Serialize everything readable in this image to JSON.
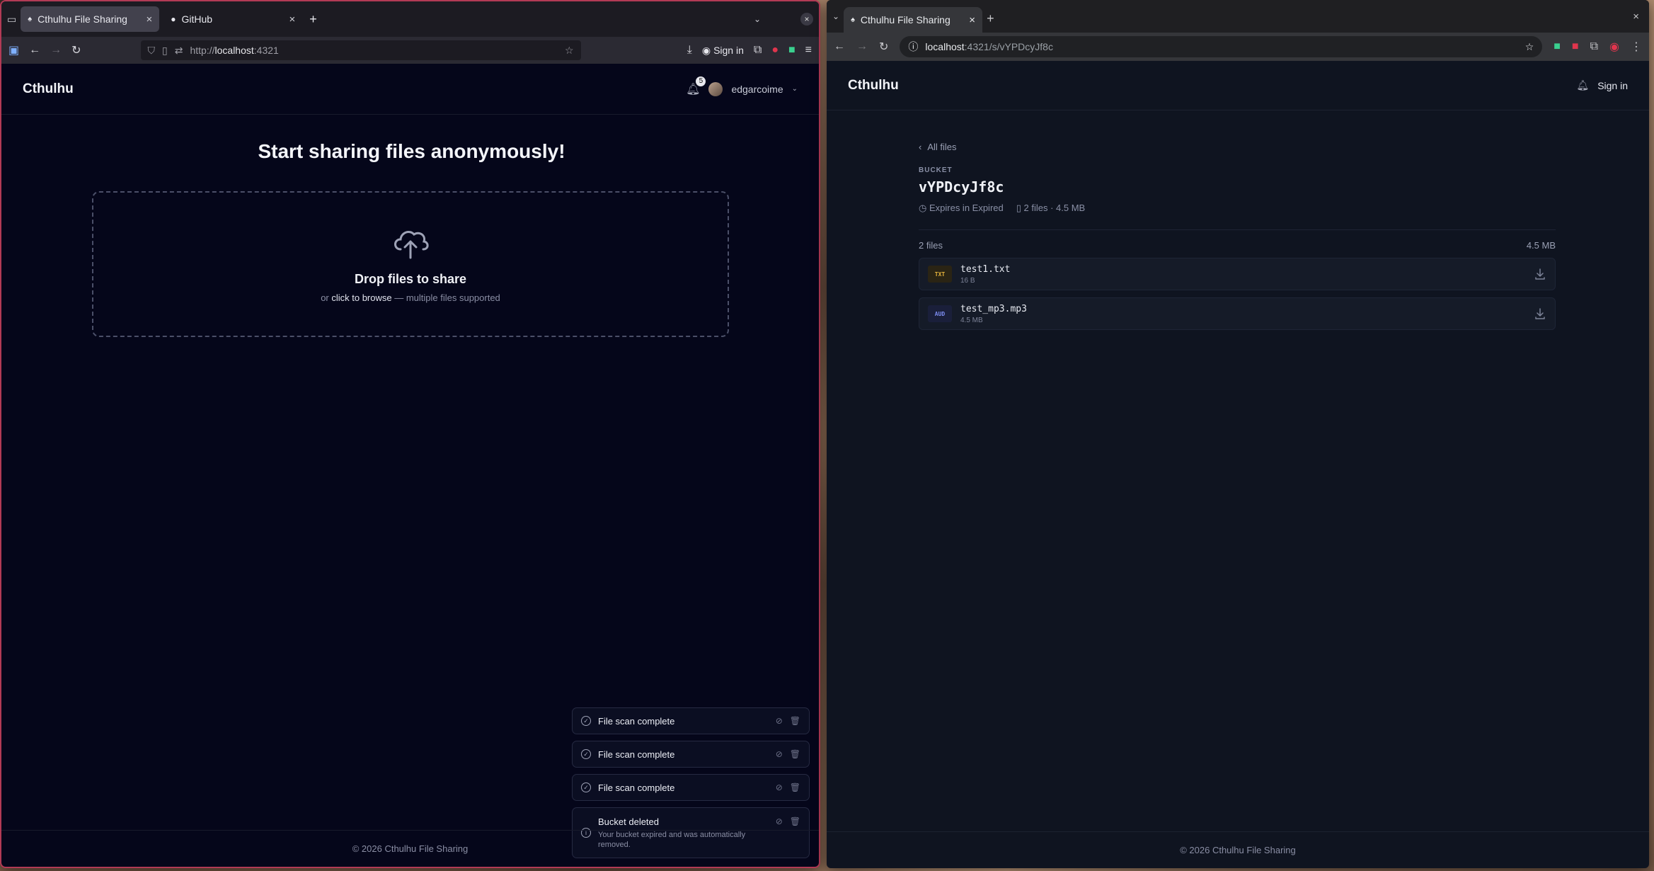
{
  "left_browser": {
    "tabs": [
      {
        "title": "Cthulhu File Sharing",
        "active": true
      },
      {
        "title": "GitHub",
        "active": false
      }
    ],
    "url_prefix": "http://",
    "url_host": "localhost",
    "url_port": ":4321",
    "signin_label": "Sign in"
  },
  "right_browser": {
    "tabs": [
      {
        "title": "Cthulhu File Sharing",
        "active": true
      }
    ],
    "url_host": "localhost",
    "url_path": ":4321/s/vYPDcyJf8c"
  },
  "left_page": {
    "brand": "Cthulhu",
    "notification_count": "5",
    "username": "edgarcoime",
    "hero_title": "Start sharing files anonymously!",
    "drop_title": "Drop files to share",
    "drop_sub_prefix": "or ",
    "drop_sub_link": "click to browse",
    "drop_sub_suffix": " — multiple files supported",
    "toasts": [
      {
        "title": "File scan complete"
      },
      {
        "title": "File scan complete"
      },
      {
        "title": "File scan complete"
      },
      {
        "title": "Bucket deleted",
        "desc": "Your bucket expired and was automatically removed."
      }
    ],
    "footer": "© 2026 Cthulhu File Sharing"
  },
  "right_page": {
    "brand": "Cthulhu",
    "signin_label": "Sign in",
    "back_label": "All files",
    "bucket_label": "BUCKET",
    "bucket_id": "vYPDcyJf8c",
    "expires": "Expires in Expired",
    "files_summary": "2 files · 4.5 MB",
    "files_count": "2 files",
    "files_total": "4.5 MB",
    "files": [
      {
        "badge": "TXT",
        "name": "test1.txt",
        "size": "16 B",
        "badge_color": "#e2b13c",
        "badge_bg": "#2a2414"
      },
      {
        "badge": "AUD",
        "name": "test_mp3.mp3",
        "size": "4.5 MB",
        "badge_color": "#7c8cf0",
        "badge_bg": "#1a1f3a"
      }
    ],
    "footer": "© 2026 Cthulhu File Sharing"
  }
}
